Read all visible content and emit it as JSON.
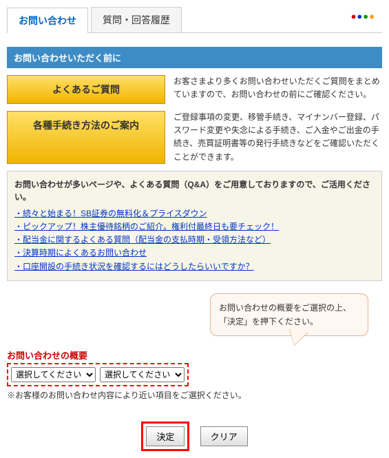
{
  "tabs": {
    "inquiry": "お問い合わせ",
    "history": "質問・回答履歴"
  },
  "section_before": "お問い合わせいただく前に",
  "faq_btn": "よくあるご質問",
  "faq_desc": "お客さまより多くお問い合わせいただくご質問をまとめていますので、お問い合わせの前にご確認ください。",
  "proc_btn": "各種手続き方法のご案内",
  "proc_desc": "ご登録事項の変更、移管手続き、マイナンバー登録、パスワード変更や失念による手続き、ご入金やご出金の手続き、売買証明書等の発行手続きなどをご確認いただくことができます。",
  "info_title": "お問い合わせが多いページや、よくある質問（Q&A）をご用意しておりますので、ご活用ください。",
  "links": [
    "・続々と始まる！SB証券の無料化＆プライスダウン",
    "・ピックアップ！株主優待銘柄のご紹介。権利付最終日も要チェック！",
    "・配当金に関するよくある質問（配当金の支払時期・受領方法など）",
    "・決算時期によくあるお問い合わせ",
    "・口座開設の手続き状況を確認するにはどうしたらいいですか？"
  ],
  "callout_line1": "お問い合わせの概要をご選択の上、",
  "callout_line2": "「決定」を押下ください。",
  "summary_label": "お問い合わせの概要",
  "select_placeholder": "選択してください",
  "note": "※お客様のお問い合わせ内容により近い項目をご選択ください。",
  "submit": "決定",
  "clear": "クリア"
}
